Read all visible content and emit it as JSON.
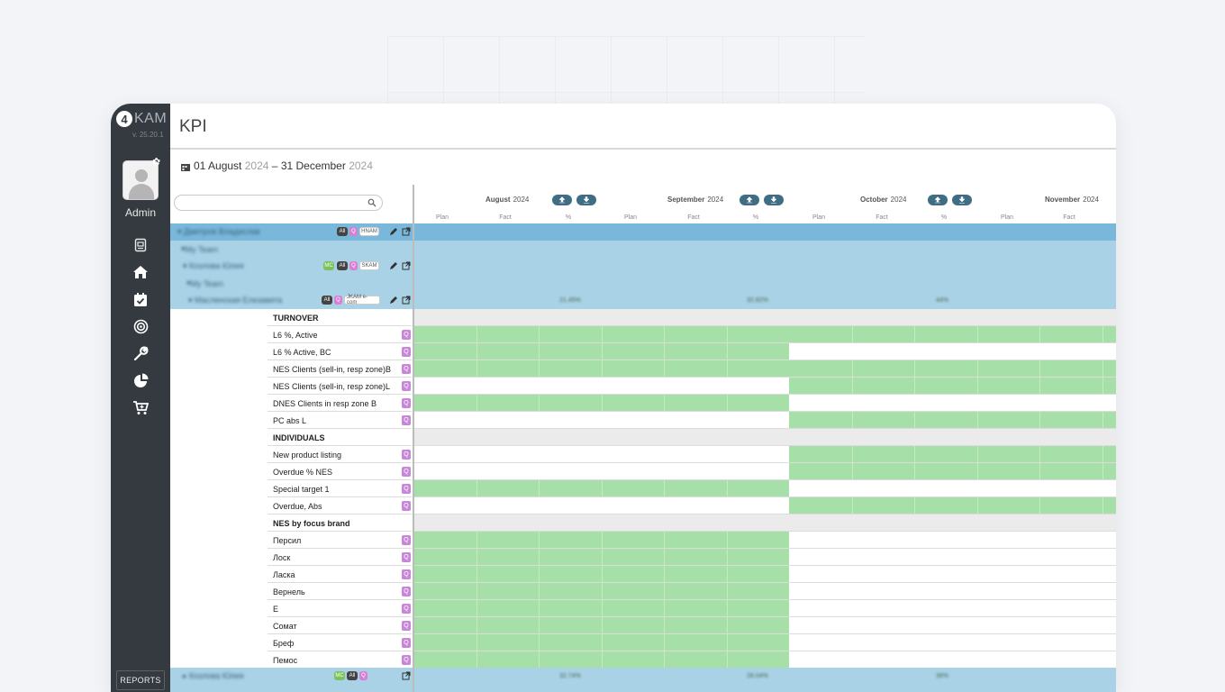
{
  "app": {
    "logo_number": "4",
    "logo_text": "KAM",
    "version": "v. 25.20.1",
    "user": "Admin",
    "reports_label": "REPORTS"
  },
  "header": {
    "title": "KPI"
  },
  "filter": {
    "date_start": "01 August",
    "date_start_year": "2024",
    "date_sep": "–",
    "date_end": "31 December",
    "date_end_year": "2024"
  },
  "search": {
    "placeholder": ""
  },
  "months": [
    {
      "name": "August",
      "year": "2024"
    },
    {
      "name": "September",
      "year": "2024"
    },
    {
      "name": "October",
      "year": "2024"
    },
    {
      "name": "November",
      "year": "2024"
    }
  ],
  "subheaders": [
    "Plan",
    "Fact",
    "%"
  ],
  "hierarchy": {
    "tags": {
      "all": "All",
      "q": "Q",
      "hnam": "HNAM",
      "skam": "SKAM",
      "mc": "MC",
      "jkam": "JKAM e-com"
    },
    "my_team": "My Team"
  },
  "kpi_rows": [
    {
      "label": "TURNOVER",
      "kind": "section"
    },
    {
      "label": "L6 %, Active",
      "kind": "kpi"
    },
    {
      "label": "L6 % Active, BC",
      "kind": "kpi"
    },
    {
      "label": "NES Clients (sell-in, resp zone)B",
      "kind": "kpi"
    },
    {
      "label": "NES Clients (sell-in, resp zone)L",
      "kind": "kpi"
    },
    {
      "label": "DNES Clients in resp zone B",
      "kind": "kpi"
    },
    {
      "label": "PC abs L",
      "kind": "kpi"
    },
    {
      "label": "INDIVIDUALS",
      "kind": "section"
    },
    {
      "label": "New product listing",
      "kind": "kpi"
    },
    {
      "label": "Overdue % NES",
      "kind": "kpi"
    },
    {
      "label": "Special target 1",
      "kind": "kpi"
    },
    {
      "label": "Overdue, Abs",
      "kind": "kpi"
    },
    {
      "label": "NES by focus brand",
      "kind": "section"
    },
    {
      "label": "Персил",
      "kind": "kpi"
    },
    {
      "label": "Лоск",
      "kind": "kpi"
    },
    {
      "label": "Ласка",
      "kind": "kpi"
    },
    {
      "label": "Вернель",
      "kind": "kpi"
    },
    {
      "label": "E",
      "kind": "kpi"
    },
    {
      "label": "Сомат",
      "kind": "kpi"
    },
    {
      "label": "Бреф",
      "kind": "kpi"
    },
    {
      "label": "Пемос",
      "kind": "kpi"
    }
  ],
  "q_badge": "Q",
  "colors": {
    "sidebar": "#343a40",
    "row_blue_dark": "#79b8da",
    "row_blue_light": "#a9d2e7",
    "cell_green": "#a7dfa8",
    "accent_pill": "#3f6e84"
  }
}
